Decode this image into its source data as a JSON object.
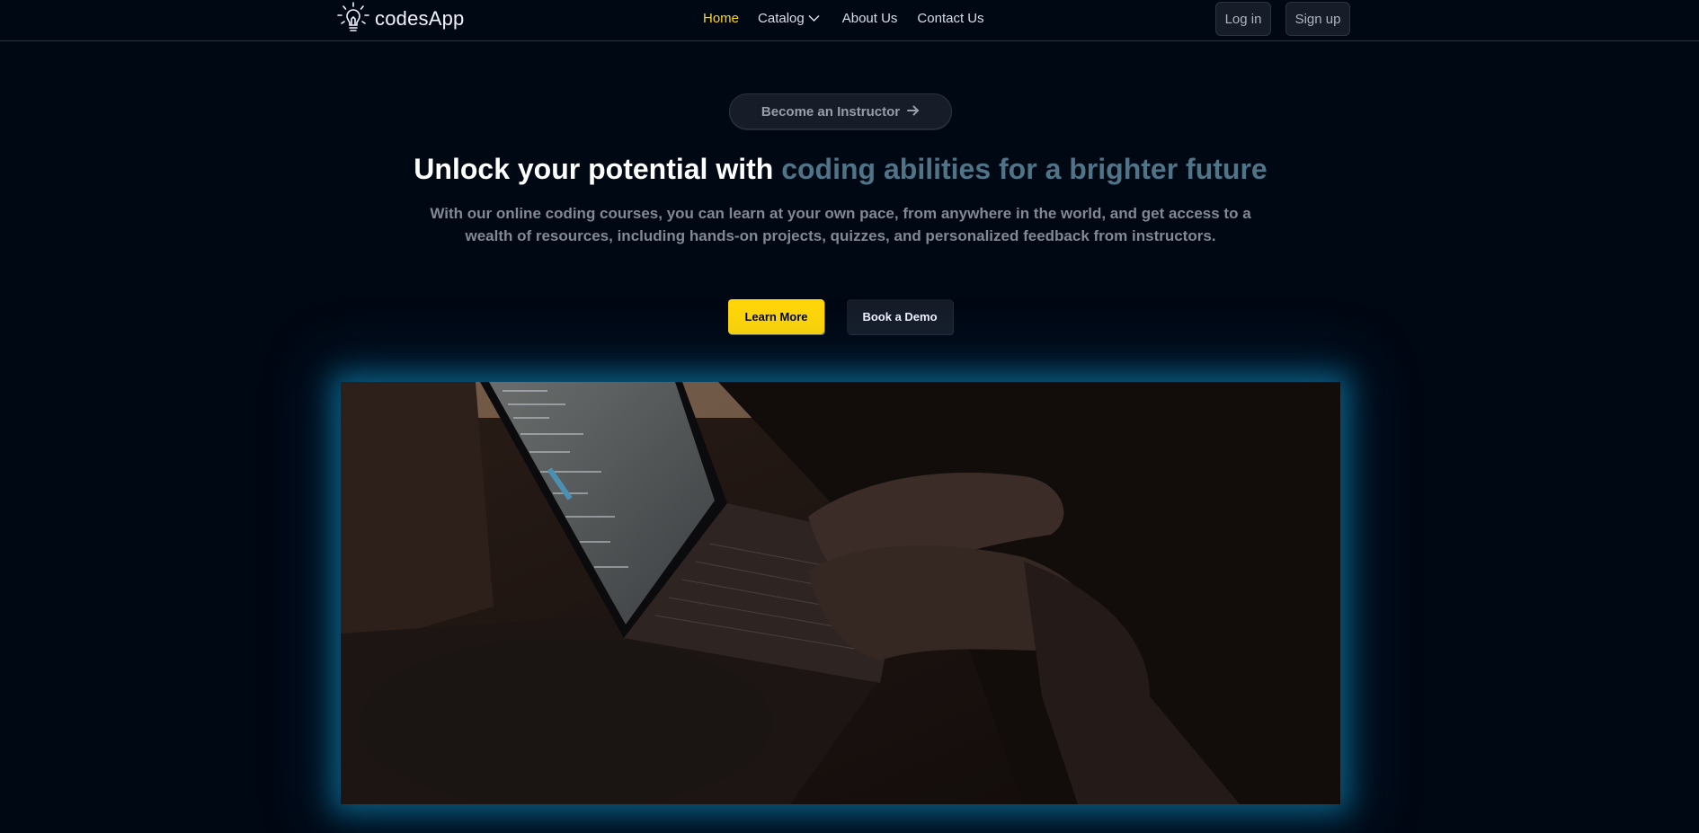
{
  "brand": {
    "name": "codesApp",
    "icon": "lightbulb-icon"
  },
  "nav": {
    "items": [
      {
        "label": "Home",
        "active": true
      },
      {
        "label": "Catalog",
        "has_dropdown": true
      },
      {
        "label": "About Us"
      },
      {
        "label": "Contact Us"
      }
    ],
    "active_color": "#ffd60a"
  },
  "auth": {
    "login_label": "Log in",
    "signup_label": "Sign up"
  },
  "hero": {
    "instructor_label": "Become an Instructor",
    "headline_plain": "Unlock your potential with ",
    "headline_accent": "coding abilities for a brighter future",
    "subtext": "With our online coding courses, you can learn at your own pace, from anywhere in the world, and get access to a wealth of resources, including hands-on projects, quizzes, and personalized feedback from instructors.",
    "learn_more_label": "Learn More",
    "book_demo_label": "Book a Demo"
  },
  "colors": {
    "background": "#000814",
    "accent_yellow": "#ffd60a",
    "headline_accent": "#4f7387",
    "glow": "#128cbe"
  }
}
